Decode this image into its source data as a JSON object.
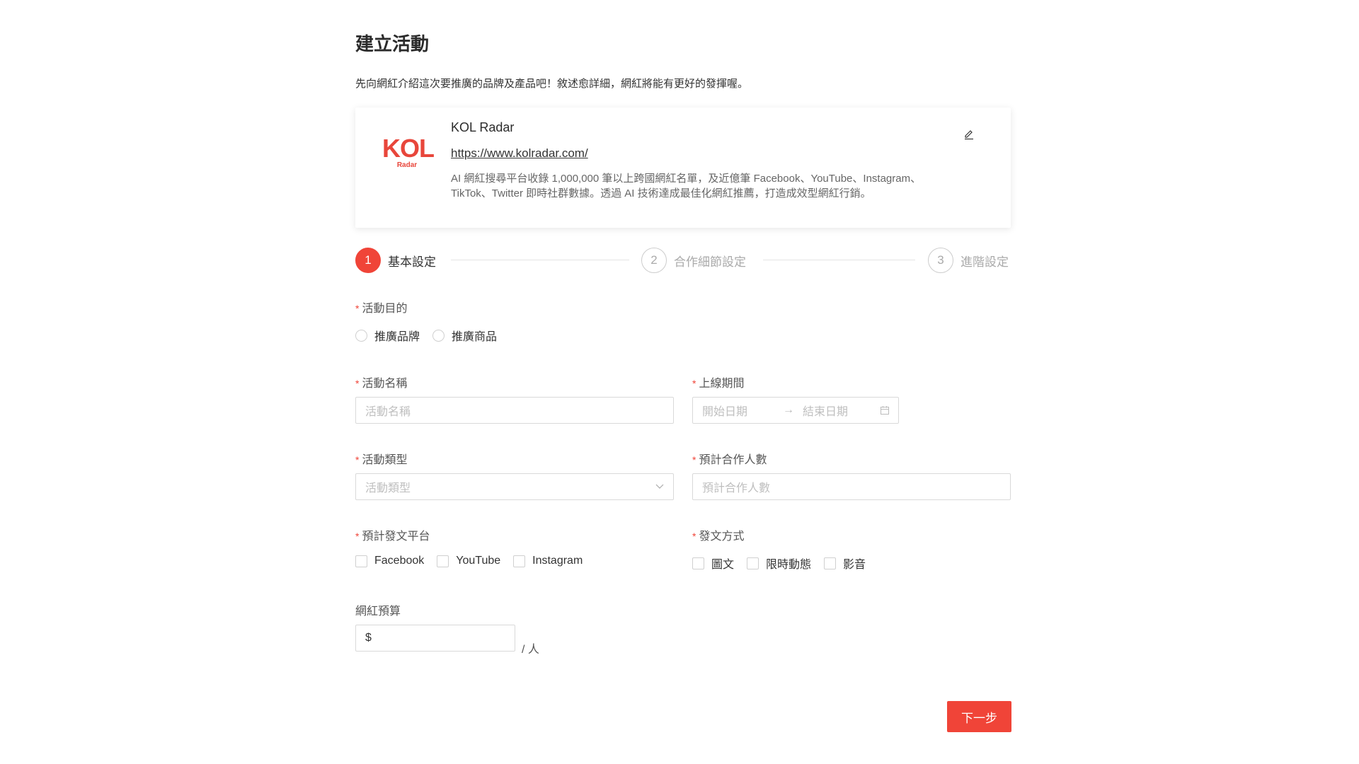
{
  "page": {
    "title": "建立活動",
    "intro": "先向網紅介紹這次要推廣的品牌及產品吧！敘述愈詳細，網紅將能有更好的發揮喔。"
  },
  "brand_card": {
    "logo_text": "KOL",
    "logo_subtext": "Radar",
    "name": "KOL Radar",
    "url": "https://www.kolradar.com/",
    "description": "AI 網紅搜尋平台收錄 1,000,000 筆以上跨國網紅名單，及近億筆 Facebook、YouTube、Instagram、TikTok、Twitter 即時社群數據。透過 AI 技術達成最佳化網紅推薦，打造成效型網紅行銷。",
    "edit_icon": "pencil-icon"
  },
  "stepper": {
    "current": 1,
    "steps": [
      {
        "number": "1",
        "label": "基本設定"
      },
      {
        "number": "2",
        "label": "合作細節設定"
      },
      {
        "number": "3",
        "label": "進階設定"
      }
    ]
  },
  "form": {
    "required_mark": "*",
    "purpose": {
      "label": "活動目的",
      "options": [
        "推廣品牌",
        "推廣商品"
      ]
    },
    "name": {
      "label": "活動名稱",
      "placeholder": "活動名稱",
      "value": ""
    },
    "period": {
      "label": "上線期間",
      "start_placeholder": "開始日期",
      "arrow": "→",
      "end_placeholder": "結束日期"
    },
    "type": {
      "label": "活動類型",
      "placeholder": "活動類型"
    },
    "headcount": {
      "label": "預計合作人數",
      "placeholder": "預計合作人數"
    },
    "platforms": {
      "label": "預計發文平台",
      "options": [
        "Facebook",
        "YouTube",
        "Instagram"
      ]
    },
    "post_format": {
      "label": "發文方式",
      "options": [
        "圖文",
        "限時動態",
        "影音"
      ]
    },
    "budget": {
      "label": "網紅預算",
      "prefix": "$",
      "unit": "/ 人"
    }
  },
  "actions": {
    "next_label": "下一步"
  },
  "colors": {
    "accent": "#f04438"
  }
}
